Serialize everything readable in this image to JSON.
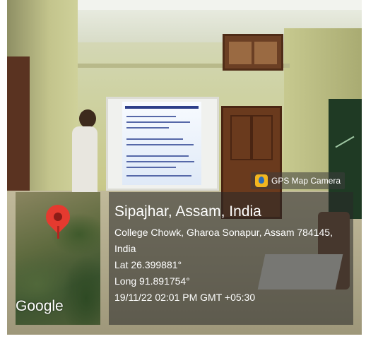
{
  "badge": {
    "label": "GPS Map Camera"
  },
  "map": {
    "provider": "Google"
  },
  "location": {
    "title": "Sipajhar, Assam, India",
    "address_line1": "College Chowk, Gharoa Sonapur, Assam 784145,",
    "address_line2": "India",
    "lat": "Lat 26.399881°",
    "long": "Long 91.891754°",
    "timestamp": "19/11/22 02:01 PM GMT +05:30"
  },
  "slide": {
    "title": "DEFINITION OF A BASS GAME (ROOTS)"
  }
}
